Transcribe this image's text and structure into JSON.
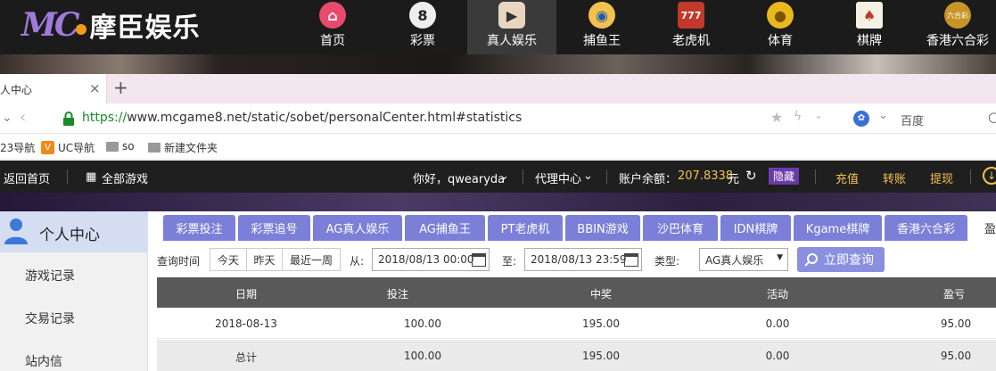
{
  "site": {
    "logo_mark": "MC",
    "brand": "摩臣娱乐",
    "nav": [
      {
        "label": "首页",
        "icon": "home-icon"
      },
      {
        "label": "彩票",
        "icon": "lottery-ball-icon"
      },
      {
        "label": "真人娱乐",
        "icon": "live-tv-icon"
      },
      {
        "label": "捕鱼王",
        "icon": "fish-icon"
      },
      {
        "label": "老虎机",
        "icon": "slot-machine-icon"
      },
      {
        "label": "体育",
        "icon": "sports-ball-icon"
      },
      {
        "label": "棋牌",
        "icon": "cards-icon"
      },
      {
        "label": "香港六合彩",
        "icon": "mark-six-icon",
        "icon_text": "六合彩"
      }
    ]
  },
  "browser": {
    "tab_title": "人中心",
    "url_scheme": "https://",
    "url_rest": "www.mcgame8.net/static/sobet/personalCenter.html#statistics",
    "search_engine": "百度",
    "bookmarks": [
      "23导航",
      "UC导航",
      "so",
      "新建文件夹"
    ]
  },
  "toolbar": {
    "home": "返回首页",
    "all_games": "全部游戏",
    "greeting": "你好，qwearyda",
    "agent": "代理中心",
    "balance_label": "账户余额：",
    "balance_value": "207.8338",
    "balance_unit": "元",
    "hide": "隐藏",
    "deposit": "充值",
    "transfer": "转账",
    "withdraw": "提现"
  },
  "sidebar": {
    "title": "个人中心",
    "items": [
      "游戏记录",
      "交易记录",
      "站内信"
    ]
  },
  "tabs": [
    "彩票投注",
    "彩票追号",
    "AG真人娱乐",
    "AG捕鱼王",
    "PT老虎机",
    "BBIN游戏",
    "沙巴体育",
    "IDN棋牌",
    "Kgame棋牌",
    "香港六合彩",
    "盈"
  ],
  "filter": {
    "label": "查询时间",
    "quick": [
      "今天",
      "昨天",
      "最近一周"
    ],
    "from_label": "从:",
    "from_value": "2018/08/13 00:00",
    "to_label": "至:",
    "to_value": "2018/08/13 23:59",
    "type_label": "类型:",
    "type_value": "AG真人娱乐",
    "query_button": "立即查询"
  },
  "table": {
    "headers": [
      "日期",
      "投注",
      "中奖",
      "活动",
      "盈亏"
    ],
    "rows": [
      [
        "2018-08-13",
        "100.00",
        "195.00",
        "0.00",
        "95.00"
      ],
      [
        "总计",
        "100.00",
        "195.00",
        "0.00",
        "95.00"
      ]
    ]
  },
  "colors": {
    "tab_purple": "#7b7fd8",
    "balance": "#f2c14e",
    "header_dark": "#595959"
  }
}
